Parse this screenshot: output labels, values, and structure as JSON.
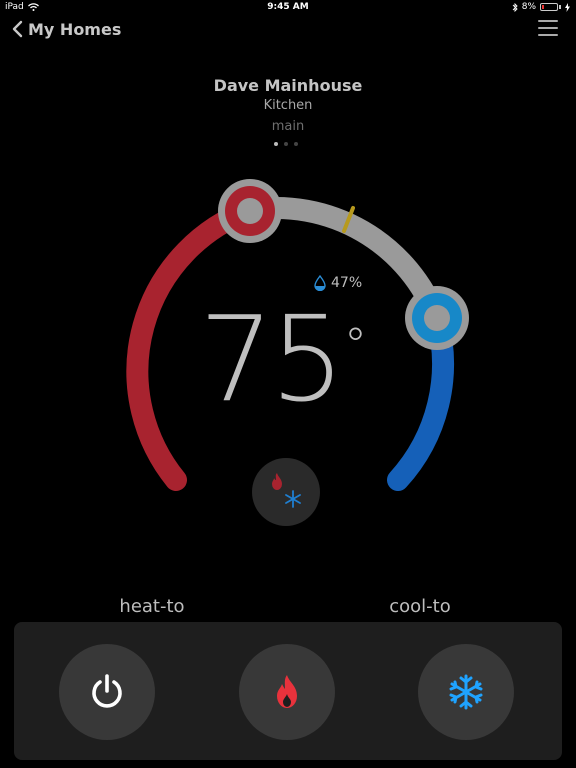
{
  "status_bar": {
    "device": "iPad",
    "time": "9:45 AM",
    "battery": "8%"
  },
  "nav": {
    "back_label": "My Homes"
  },
  "location": {
    "home": "Dave Mainhouse",
    "room": "Kitchen",
    "zone": "main"
  },
  "pagination": {
    "total": 3,
    "active": 1
  },
  "thermostat": {
    "current_temp": "75",
    "degree_symbol": "°",
    "humidity": "47%",
    "heat_label": "heat-to",
    "cool_label": "cool-to",
    "mode": "heat-cool"
  },
  "controls": {
    "power": "power-icon",
    "heat": "flame-icon",
    "cool": "snowflake-icon"
  },
  "colors": {
    "heat": "#a8232f",
    "cool": "#1560b8",
    "track": "#9a9a9a",
    "marker": "#b79a1e",
    "heat_icon": "#e8323c",
    "cool_icon": "#1fa3ff"
  }
}
